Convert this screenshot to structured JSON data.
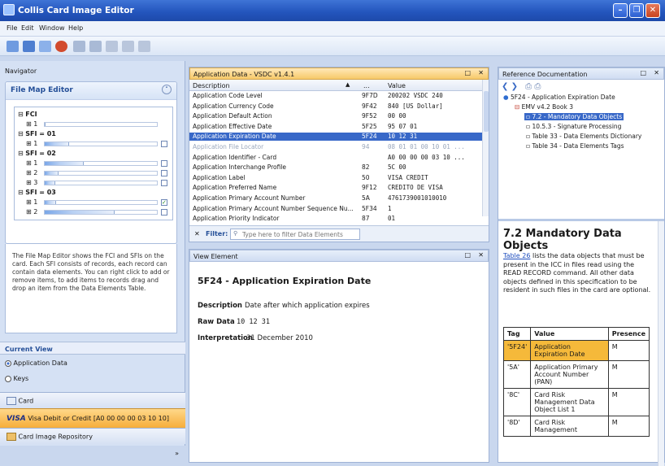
{
  "window": {
    "title": "Collis Card Image Editor"
  },
  "menu": [
    "File",
    "Edit",
    "Window",
    "Help"
  ],
  "navigator": {
    "title": "Navigator",
    "file_map_editor": {
      "title": "File Map Editor",
      "tree": [
        {
          "label": "FCI",
          "bar": 0.35
        },
        {
          "label": "1",
          "bar": 0.0
        },
        {
          "label": "SFI = 01",
          "bar": 0.0
        },
        {
          "label": "1",
          "bar": 0.22
        },
        {
          "label": "SFI = 02",
          "bar": 0.0
        },
        {
          "label": "1",
          "bar": 0.35
        },
        {
          "label": "2",
          "bar": 0.13
        },
        {
          "label": "3",
          "bar": 0.1
        },
        {
          "label": "SFI = 03",
          "bar": 0.0
        },
        {
          "label": "1",
          "bar": 0.11
        },
        {
          "label": "2",
          "bar": 0.62
        }
      ],
      "description": "The File Map Editor shows the FCI and SFIs on the card. Each SFI consists of records, each record can contain data elements. You can right click to add or remove items, to add items to records drag and drop an item from the Data Elements Table."
    },
    "current_view": {
      "title": "Current View",
      "options": [
        "Application Data",
        "Keys"
      ],
      "selected": "Application Data"
    },
    "sections": [
      {
        "label": "Card"
      },
      {
        "label": "Visa Debit or Credit [A0 00 00 00 03 10 10]",
        "brand": "VISA"
      },
      {
        "label": "Card Image Repository"
      }
    ]
  },
  "app_data": {
    "title": "Application Data - VSDC v1.4.1",
    "columns": [
      "Description",
      "...",
      "Value"
    ],
    "rows": [
      {
        "desc": "Application Code Level",
        "tag": "9F7D",
        "value": "200202 VSDC 240",
        "state": "normal"
      },
      {
        "desc": "Application Currency Code",
        "tag": "9F42",
        "value": "840 [US Dollar]",
        "state": "normal"
      },
      {
        "desc": "Application Default Action",
        "tag": "9F52",
        "value": "00 00",
        "state": "normal"
      },
      {
        "desc": "Application Effective Date",
        "tag": "5F25",
        "value": "95 07 01",
        "state": "normal"
      },
      {
        "desc": "Application Expiration Date",
        "tag": "5F24",
        "value": "10 12 31",
        "state": "selected"
      },
      {
        "desc": "Application File Locator",
        "tag": "94",
        "value": "08 01 01 00 10 01 ...",
        "state": "dim"
      },
      {
        "desc": "Application Identifier - Card",
        "tag": "",
        "value": "A0 00 00 00 03 10 ...",
        "state": "normal"
      },
      {
        "desc": "Application Interchange Profile",
        "tag": "82",
        "value": "5C 00",
        "state": "normal"
      },
      {
        "desc": "Application Label",
        "tag": "50",
        "value": "VISA CREDIT",
        "state": "normal"
      },
      {
        "desc": "Application Preferred Name",
        "tag": "9F12",
        "value": "CREDITO DE VISA",
        "state": "normal"
      },
      {
        "desc": "Application Primary Account Number",
        "tag": "5A",
        "value": "4761739001010010",
        "state": "normal"
      },
      {
        "desc": "Application Primary Account Number Sequence Nu...",
        "tag": "5F34",
        "value": "1",
        "state": "normal"
      },
      {
        "desc": "Application Priority Indicator",
        "tag": "87",
        "value": "01",
        "state": "normal"
      }
    ],
    "filter_label": "Filter:",
    "filter_placeholder": "Type here to filter Data Elements"
  },
  "view_element": {
    "title": "View Element",
    "heading": "5F24 - Application Expiration Date",
    "fields": [
      {
        "label": "Description",
        "value": "Date after which application expires"
      },
      {
        "label": "Raw Data",
        "value": "10 12 31"
      },
      {
        "label": "Interpretation",
        "value": "31 December 2010"
      }
    ]
  },
  "reference": {
    "title": "Reference Documentation",
    "tree": [
      {
        "label": "5F24 - Application Expiration Date",
        "level": 0
      },
      {
        "label": "EMV v4.2 Book 3",
        "level": 1
      },
      {
        "label": "7.2 - Mandatory Data Objects",
        "level": 2,
        "selected": true
      },
      {
        "label": "10.5.3 - Signature Processing",
        "level": 2
      },
      {
        "label": "Table 33 - Data Elements Dictionary",
        "level": 2
      },
      {
        "label": "Table 34 - Data Elements Tags",
        "level": 2
      }
    ],
    "doc": {
      "heading": "7.2 Mandatory Data Objects",
      "link": "Table 26",
      "body": "lists the data objects that must be present in the ICC in files read using the READ RECORD command. All other data objects defined in this specification to be resident in such files in the card are optional.",
      "table_headers": [
        "Tag",
        "Value",
        "Presence"
      ],
      "table_rows": [
        {
          "tag": "'5F24'",
          "value": "Application Expiration Date",
          "presence": "M",
          "highlight": true
        },
        {
          "tag": "'5A'",
          "value": "Application Primary Account Number (PAN)",
          "presence": "M"
        },
        {
          "tag": "'8C'",
          "value": "Card Risk Management Data Object List 1",
          "presence": "M"
        },
        {
          "tag": "'8D'",
          "value": "Card Risk Management",
          "presence": "M"
        }
      ]
    }
  }
}
